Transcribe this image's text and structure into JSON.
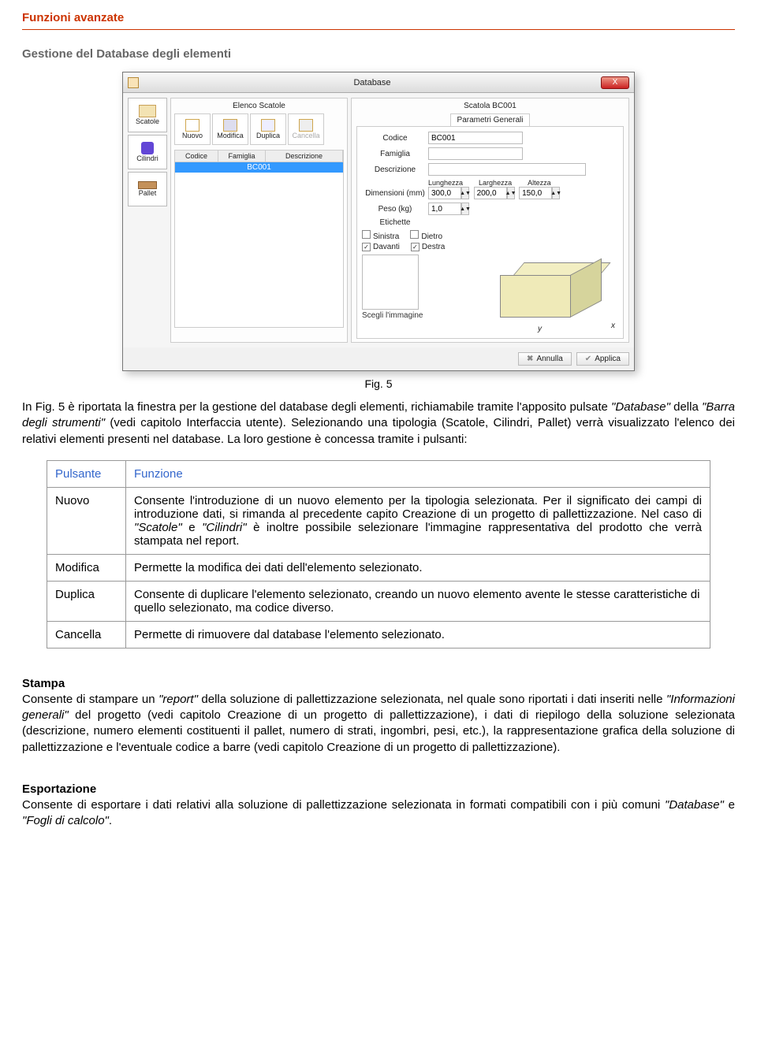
{
  "headings": {
    "h1": "Funzioni avanzate",
    "h2": "Gestione del Database degli elementi"
  },
  "caption": "Fig. 5",
  "para1_a": "In Fig. 5 è riportata la finestra per la gestione del database degli elementi, richiamabile tramite l'apposito pulsate ",
  "para1_b": "\"Database\"",
  "para1_c": " della ",
  "para1_d": "\"Barra degli strumenti\"",
  "para1_e": " (vedi capitolo Interfaccia utente). Selezionando una tipologia (Scatole, Cilindri, Pallet) verrà visualizzato l'elenco dei relativi elementi presenti nel database. La loro gestione è concessa tramite i pulsanti:",
  "table": {
    "h_pulsante": "Pulsante",
    "h_funzione": "Funzione",
    "nuovo_label": "Nuovo",
    "nuovo_text_a": "Consente l'introduzione di un nuovo elemento per la tipologia selezionata. Per il significato dei campi di introduzione dati, si rimanda al precedente capito Creazione   di   un   progetto   di   pallettizzazione.   Nel   caso di ",
    "nuovo_text_b": "\"Scatole\"",
    "nuovo_text_c": " e ",
    "nuovo_text_d": "\"Cilindri\"",
    "nuovo_text_e": " è inoltre possibile selezionare l'immagine rappresentativa del prodotto che verrà stampata nel report.",
    "modifica_label": "Modifica",
    "modifica_text": "Permette la modifica dei dati dell'elemento selezionato.",
    "duplica_label": "Duplica",
    "duplica_text": "Consente di duplicare l'elemento selezionato, creando un nuovo elemento avente le stesse caratteristiche di quello selezionato, ma codice diverso.",
    "cancella_label": "Cancella",
    "cancella_text": "Permette di rimuovere dal database l'elemento selezionato."
  },
  "stampa": {
    "title": "Stampa",
    "a": "Consente di stampare un ",
    "b": "\"report\"",
    "c": " della soluzione di pallettizzazione selezionata, nel quale sono riportati i dati inseriti nelle ",
    "d": "\"Informazioni generali\"",
    "e": " del progetto (vedi capitolo Creazione di un progetto di pallettizzazione), i dati di riepilogo della soluzione selezionata (descrizione, numero elementi costituenti il pallet, numero di strati, ingombri, pesi, etc.), la rappresentazione grafica della soluzione di pallettizzazione e l'eventuale codice a barre (vedi capitolo Creazione di un progetto di pallettizzazione)."
  },
  "esportazione": {
    "title": "Esportazione",
    "a": "Consente di esportare i dati relativi alla soluzione di pallettizzazione selezionata in formati compatibili con i più comuni ",
    "b": "\"Database\"",
    "c": " e ",
    "d": "\"Fogli di calcolo\"",
    "e": "."
  },
  "win": {
    "title": "Database",
    "close": "X",
    "side": {
      "scatole": "Scatole",
      "cilindri": "Cilindri",
      "pallet": "Pallet"
    },
    "mid": {
      "title": "Elenco Scatole",
      "nuovo": "Nuovo",
      "modifica": "Modifica",
      "duplica": "Duplica",
      "cancella": "Cancella",
      "col_codice": "Codice",
      "col_famiglia": "Famiglia",
      "col_descr": "Descrizione",
      "row1": "BC001"
    },
    "right": {
      "title": "Scatola BC001",
      "tab": "Parametri Generali",
      "l_codice": "Codice",
      "v_codice": "BC001",
      "l_famiglia": "Famiglia",
      "v_famiglia": "",
      "l_descr": "Descrizione",
      "v_descr": "",
      "l_dim": "Dimensioni (mm)",
      "l_lung": "Lunghezza",
      "v_lung": "300,0",
      "l_larg": "Larghezza",
      "v_larg": "200,0",
      "l_alt": "Altezza",
      "v_alt": "150,0",
      "l_peso": "Peso (kg)",
      "v_peso": "1,0",
      "l_eti": "Etichette",
      "e_sin": "Sinistra",
      "e_die": "Dietro",
      "e_dav": "Davanti",
      "e_des": "Destra",
      "imglink": "Scegli l'immagine",
      "ax_x": "x",
      "ax_y": "y"
    },
    "btn": {
      "annulla": "Annulla",
      "applica": "Applica"
    }
  }
}
